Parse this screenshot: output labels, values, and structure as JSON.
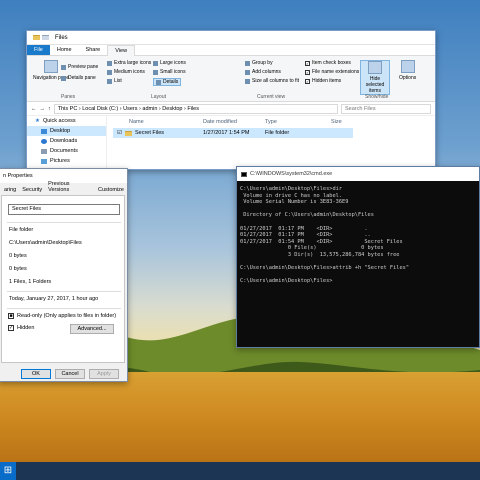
{
  "explorer": {
    "title": "Files",
    "tabs": [
      "File",
      "Home",
      "Share",
      "View"
    ],
    "ribbon": {
      "navigation_pane": "Navigation pane",
      "preview_pane": "Preview pane",
      "details_pane": "Details pane",
      "panes_group": "Panes",
      "layouts": [
        "Extra large icons",
        "Large icons",
        "Medium icons",
        "Small icons",
        "List",
        "Details"
      ],
      "layout_group": "Layout",
      "group_by": "Group by",
      "add_columns": "Add columns",
      "size_all_columns": "Size all columns to fit",
      "current_view_group": "Current view",
      "item_check_boxes": "Item check boxes",
      "file_name_extensions": "File name extensions",
      "hidden_items": "Hidden items",
      "hide_selected_items": "Hide selected items",
      "show_hide_group": "Show/hide",
      "options": "Options"
    },
    "address": [
      "This PC",
      "Local Disk (C:)",
      "Users",
      "admin",
      "Desktop",
      "Files"
    ],
    "search_placeholder": "Search Files",
    "nav": {
      "quick_access": "Quick access",
      "items": [
        "Desktop",
        "Downloads",
        "Documents",
        "Pictures"
      ]
    },
    "columns": [
      "Name",
      "Date modified",
      "Type",
      "Size"
    ],
    "rows": [
      {
        "name": "Secret Files",
        "date": "1/27/2017 1:54 PM",
        "type": "File folder",
        "size": ""
      }
    ]
  },
  "properties": {
    "title": "n Properties",
    "tabs": [
      "aring",
      "Security",
      "Previous Versions",
      "Customize"
    ],
    "name_value": "Secret Files",
    "type": "File folder",
    "location": "C:\\Users\\admin\\Desktop\\Files",
    "size": "0 bytes",
    "size_on_disk": "0 bytes",
    "contains": "1 Files, 1 Folders",
    "created": "Today, January 27, 2017, 1 hour ago",
    "readonly_label": "Read-only (Only applies to files in folder)",
    "hidden_label": "Hidden",
    "advanced_label": "Advanced...",
    "ok": "OK",
    "cancel": "Cancel",
    "apply": "Apply"
  },
  "cmd": {
    "title": "C:\\WINDOWS\\system32\\cmd.exe",
    "lines": [
      "C:\\Users\\admin\\Desktop\\Files>dir",
      " Volume in drive C has no label.",
      " Volume Serial Number is 3E83-36E9",
      "",
      " Directory of C:\\Users\\admin\\Desktop\\Files",
      "",
      "01/27/2017  01:17 PM    <DIR>          .",
      "01/27/2017  01:17 PM    <DIR>          ..",
      "01/27/2017  01:54 PM    <DIR>          Secret Files",
      "               0 File(s)              0 bytes",
      "               3 Dir(s)  13,575,286,784 bytes free",
      "",
      "C:\\Users\\admin\\Desktop\\Files>attrib +h \"Secret Files\"",
      "",
      "C:\\Users\\admin\\Desktop\\Files>"
    ]
  },
  "colors": {
    "accent": "#1979ca",
    "selection": "#cce8ff",
    "console_bg": "#0c0c0c"
  }
}
